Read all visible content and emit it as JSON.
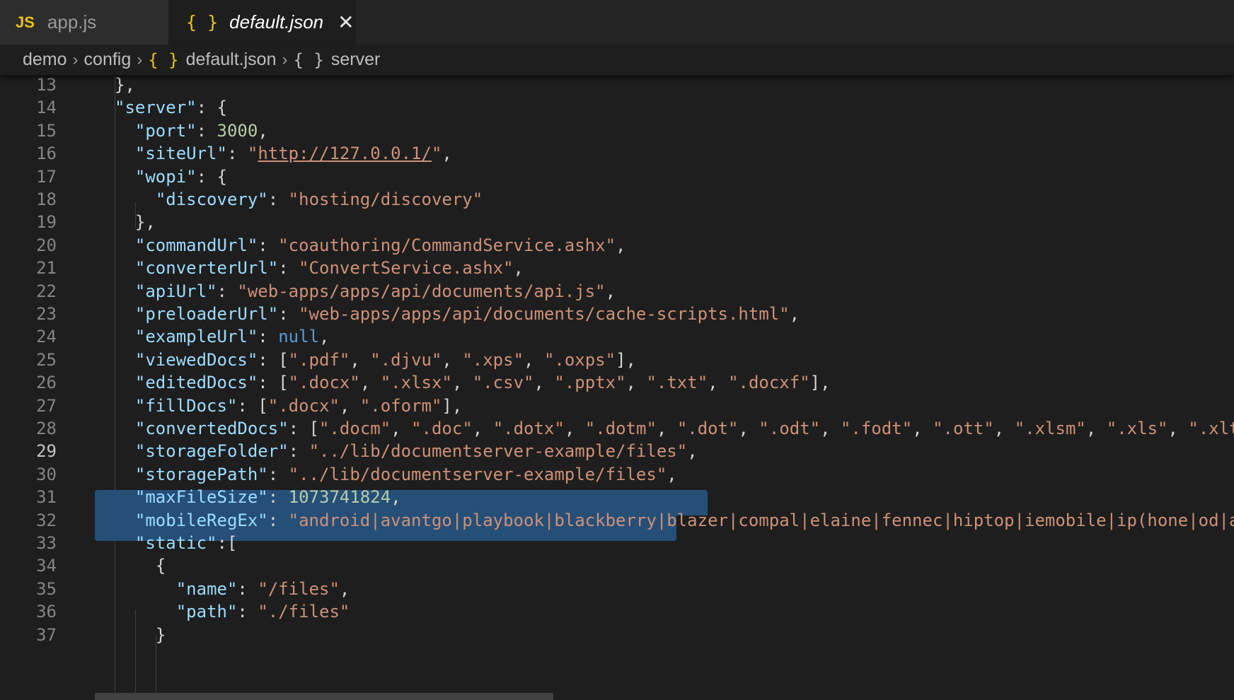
{
  "tabs": [
    {
      "icon": "JS",
      "label": "app.js",
      "active": false
    },
    {
      "icon": "{ }",
      "label": "default.json",
      "active": true,
      "close": "✕"
    }
  ],
  "breadcrumb": {
    "items": [
      "demo",
      "config",
      "default.json",
      "server"
    ],
    "icon_braces": "{ }",
    "separator": "›"
  },
  "editor": {
    "current_line": 29,
    "lines": [
      {
        "n": "13",
        "code": "},"
      },
      {
        "n": "14",
        "code": "\"server\": {"
      },
      {
        "n": "15",
        "code": "  \"port\": 3000,"
      },
      {
        "n": "16",
        "code": "  \"siteUrl\": \"http://127.0.0.1/\","
      },
      {
        "n": "17",
        "code": "  \"wopi\": {"
      },
      {
        "n": "18",
        "code": "    \"discovery\": \"hosting/discovery\""
      },
      {
        "n": "19",
        "code": "  },"
      },
      {
        "n": "20",
        "code": "  \"commandUrl\": \"coauthoring/CommandService.ashx\","
      },
      {
        "n": "21",
        "code": "  \"converterUrl\": \"ConvertService.ashx\","
      },
      {
        "n": "22",
        "code": "  \"apiUrl\": \"web-apps/apps/api/documents/api.js\","
      },
      {
        "n": "23",
        "code": "  \"preloaderUrl\": \"web-apps/apps/api/documents/cache-scripts.html\","
      },
      {
        "n": "24",
        "code": "  \"exampleUrl\": null,"
      },
      {
        "n": "25",
        "code": "  \"viewedDocs\": [\".pdf\", \".djvu\", \".xps\", \".oxps\"],"
      },
      {
        "n": "26",
        "code": "  \"editedDocs\": [\".docx\", \".xlsx\", \".csv\", \".pptx\", \".txt\", \".docxf\"],"
      },
      {
        "n": "27",
        "code": "  \"fillDocs\": [\".docx\", \".oform\"],"
      },
      {
        "n": "28",
        "code": "  \"convertedDocs\": [\".docm\", \".doc\", \".dotx\", \".dotm\", \".dot\", \".odt\", \".fodt\", \".ott\", \".xlsm\", \".xls\", \".xlt"
      },
      {
        "n": "29",
        "code": "  \"storageFolder\": \"../lib/documentserver-example/files\","
      },
      {
        "n": "30",
        "code": "  \"storagePath\": \"../lib/documentserver-example/files\","
      },
      {
        "n": "31",
        "code": "  \"maxFileSize\": 1073741824,"
      },
      {
        "n": "32",
        "code": "  \"mobileRegEx\": \"android|avantgo|playbook|blackberry|blazer|compal|elaine|fennec|hiptop|iemobile|ip(hone|od|a"
      },
      {
        "n": "33",
        "code": "  \"static\":["
      },
      {
        "n": "34",
        "code": "    {"
      },
      {
        "n": "35",
        "code": "      \"name\": \"/files\","
      },
      {
        "n": "36",
        "code": "      \"path\": \"./files\""
      },
      {
        "n": "37",
        "code": "    }"
      }
    ]
  },
  "colors": {
    "key": "#9cdcfe",
    "string": "#ce9178",
    "number": "#b5cea8",
    "keyword": "#569cd6",
    "selection": "#264f78",
    "icon_accent": "#e8c31b"
  }
}
